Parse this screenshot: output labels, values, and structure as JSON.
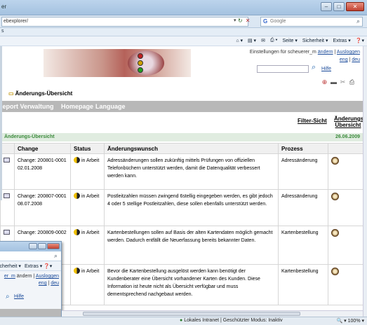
{
  "browser": {
    "title": "er",
    "address": "ebexplorer/",
    "search_placeholder": "Google",
    "favorites_label": "s",
    "commands": [
      "Seite ▾",
      "Sicherheit ▾",
      "Extras ▾",
      "❓▾"
    ]
  },
  "header": {
    "settings_text": "Einstellungen für scheuerer_m",
    "settings_link": "ändern",
    "logout": "Ausloggen",
    "lang_eng": "eng",
    "lang_deu": "deu",
    "hilfe": "Hilfe"
  },
  "page": {
    "title": "Änderungs-Übersicht",
    "menu": [
      "Report Verwaltung",
      "Homepage",
      "Language"
    ],
    "filter_tabs": [
      "Filter-Sicht",
      "Änderungs Übersicht"
    ],
    "section_title": "Änderungs-Übersicht",
    "section_date": "26.06.2009"
  },
  "table": {
    "columns": [
      "",
      "Change",
      "Status",
      "Änderungswunsch",
      "Prozess",
      ""
    ],
    "rows": [
      {
        "change": "Change: 200801-0001",
        "date": "02.01.2008",
        "status": "in Arbeit",
        "wish": "Adressänderungen sollen zukünftig mittels Prüfungen von offiziellen Telefonbüchern unterstützt werden, damit die Datenqualität verbessert werden kann.",
        "process": "Adressänderung"
      },
      {
        "change": "Change: 200807-0001",
        "date": "08.07.2008",
        "status": "in Arbeit",
        "wish": "Postleitzahlen müssen zwingend 6stellig eingegeben werden, es gibt jedoch 4 oder 5 stellige Postleitzahlen, diese sollen ebenfalls unterstützt werden.",
        "process": "Adressänderung"
      },
      {
        "change": "Change: 200809-0002",
        "date": "",
        "status": "in Arbeit",
        "wish": "Kartenbestellungen sollen auf Basis der alten Kartendaten möglich gemacht werden. Dadurch entfällt die Neuerfassung bereits bekannter Daten.",
        "process": "Kartenbestellung"
      },
      {
        "change": "",
        "date": "",
        "status": "in Arbeit",
        "wish": "Bevor die Kartenbestellung ausgelöst werden kann benötigt der Kundenberater eine Übersicht vorhandener Karten des Kunden. Diese Information ist heute nicht als Übersicht verfügbar und muss dementsprechend nachgebaut werden.",
        "process": "Kartenbestellung"
      }
    ]
  },
  "window2": {
    "commands": [
      "icherheit ▾",
      "Extras ▾",
      "❓▾"
    ],
    "settings_prefix": "er_m",
    "settings_link": "ändern",
    "logout": "Ausloggen",
    "lang_eng": "eng",
    "lang_deu": "deu",
    "hilfe": "Hilfe"
  },
  "status": {
    "zone": "Lokales Intranet | Geschützter Modus: Inaktiv",
    "zoom": "🔍 ▾ 100% ▾",
    "zoom_value": "100%"
  },
  "colors": {
    "menubar": "#b8b8b8",
    "section_green": "#3a8a3a",
    "link_blue": "#1a4a9a"
  }
}
